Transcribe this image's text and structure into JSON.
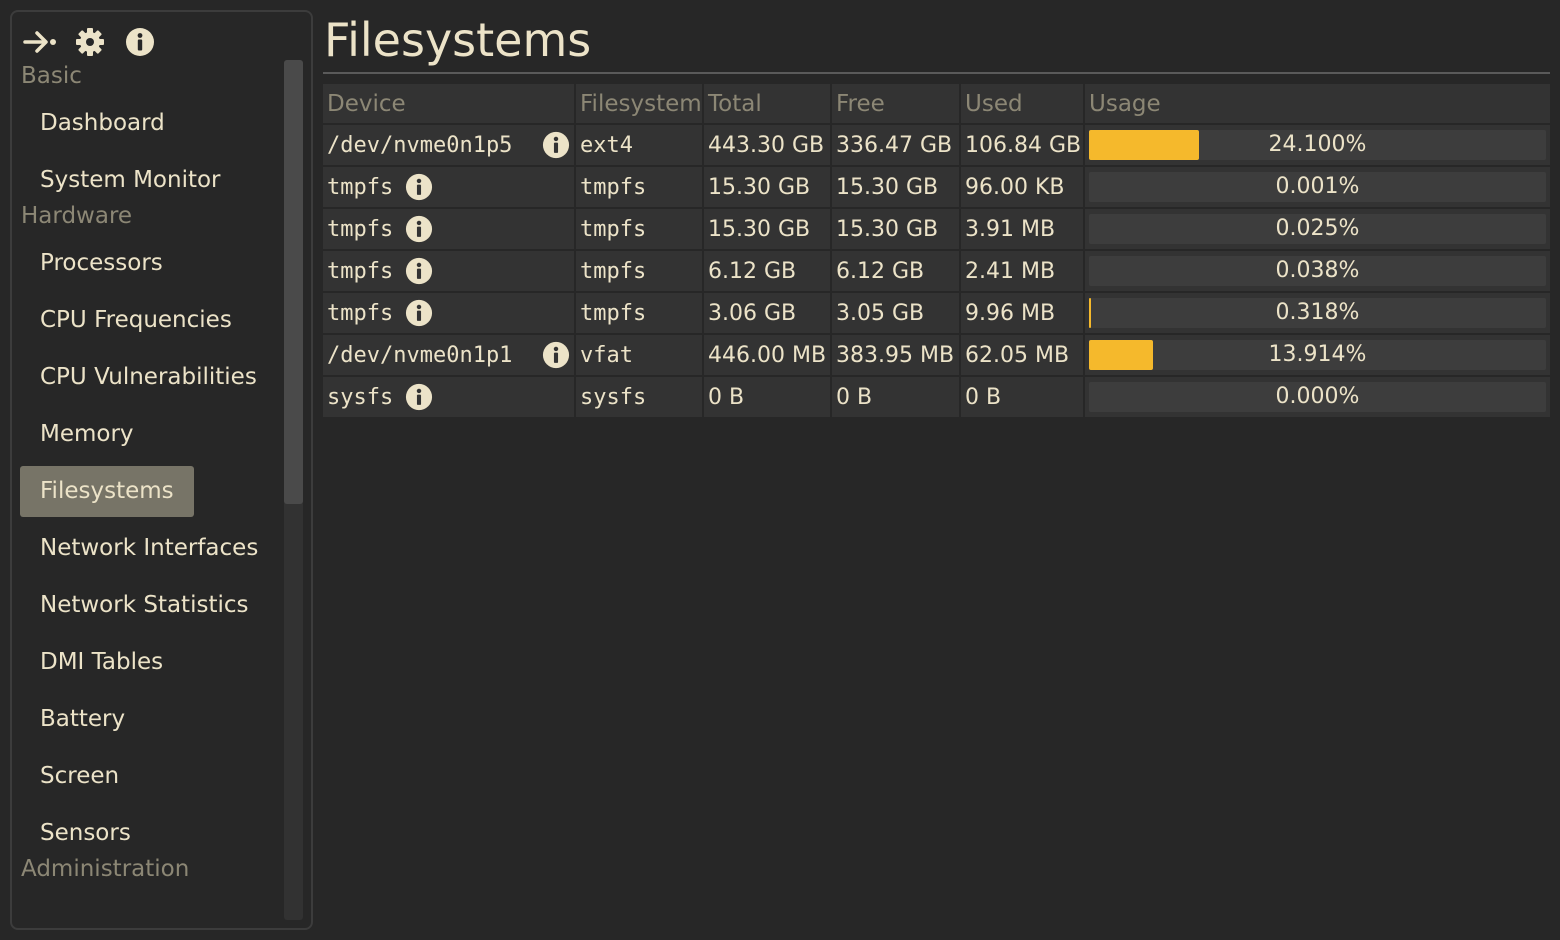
{
  "toolbar": {
    "icons": [
      "collapse-sidebar-icon",
      "gear-icon",
      "info-icon"
    ]
  },
  "sidebar": {
    "sections": [
      {
        "label": "Basic",
        "items": [
          {
            "label": "Dashboard",
            "active": false
          },
          {
            "label": "System Monitor",
            "active": false
          }
        ]
      },
      {
        "label": "Hardware",
        "items": [
          {
            "label": "Processors",
            "active": false
          },
          {
            "label": "CPU Frequencies",
            "active": false
          },
          {
            "label": "CPU Vulnerabilities",
            "active": false
          },
          {
            "label": "Memory",
            "active": false
          },
          {
            "label": "Filesystems",
            "active": true
          },
          {
            "label": "Network Interfaces",
            "active": false
          },
          {
            "label": "Network Statistics",
            "active": false
          },
          {
            "label": "DMI Tables",
            "active": false
          },
          {
            "label": "Battery",
            "active": false
          },
          {
            "label": "Screen",
            "active": false
          },
          {
            "label": "Sensors",
            "active": false
          }
        ]
      },
      {
        "label": "Administration",
        "items": []
      }
    ]
  },
  "page": {
    "title": "Filesystems"
  },
  "table": {
    "columns": [
      "Device",
      "Filesystem",
      "Total",
      "Free",
      "Used",
      "Usage"
    ],
    "rows": [
      {
        "device": "/dev/nvme0n1p5",
        "fs": "ext4",
        "total": "443.30 GB",
        "free": "336.47 GB",
        "used": "106.84 GB",
        "usage_label": "24.100%",
        "usage": 24.1
      },
      {
        "device": "tmpfs",
        "fs": "tmpfs",
        "total": "15.30 GB",
        "free": "15.30 GB",
        "used": "96.00 KB",
        "usage_label": "0.001%",
        "usage": 0.001
      },
      {
        "device": "tmpfs",
        "fs": "tmpfs",
        "total": "15.30 GB",
        "free": "15.30 GB",
        "used": "3.91 MB",
        "usage_label": "0.025%",
        "usage": 0.025
      },
      {
        "device": "tmpfs",
        "fs": "tmpfs",
        "total": "6.12 GB",
        "free": "6.12 GB",
        "used": "2.41 MB",
        "usage_label": "0.038%",
        "usage": 0.038
      },
      {
        "device": "tmpfs",
        "fs": "tmpfs",
        "total": "3.06 GB",
        "free": "3.05 GB",
        "used": "9.96 MB",
        "usage_label": "0.318%",
        "usage": 0.318
      },
      {
        "device": "/dev/nvme0n1p1",
        "fs": "vfat",
        "total": "446.00 MB",
        "free": "383.95 MB",
        "used": "62.05 MB",
        "usage_label": "13.914%",
        "usage": 13.914
      },
      {
        "device": "sysfs",
        "fs": "sysfs",
        "total": "0 B",
        "free": "0 B",
        "used": "0 B",
        "usage_label": "0.000%",
        "usage": 0.0
      }
    ]
  },
  "colors": {
    "background": "#272727",
    "panel": "#333333",
    "text": "#ece3c8",
    "muted": "#8c8775",
    "accent": "#f5b92c",
    "active_nav": "#777467"
  }
}
